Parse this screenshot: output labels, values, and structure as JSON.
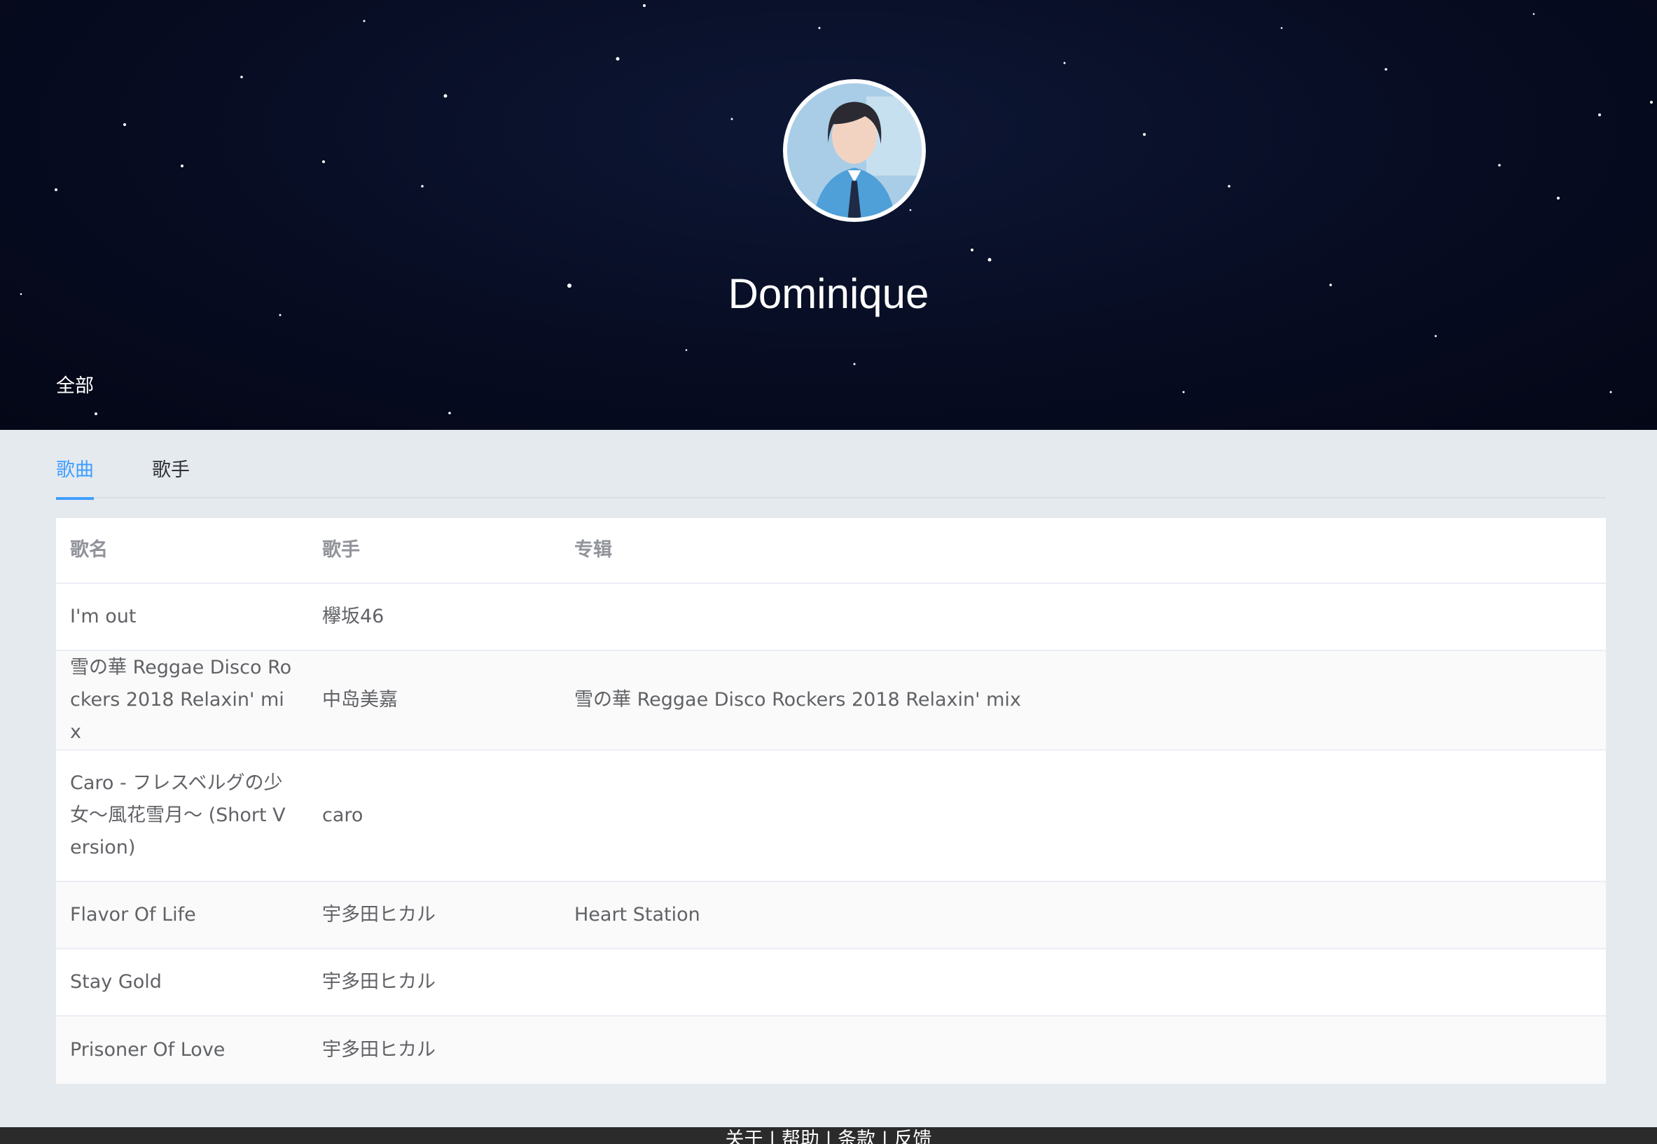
{
  "profile": {
    "username": "Dominique",
    "all_label": "全部"
  },
  "tabs": [
    {
      "label": "歌曲",
      "active": true
    },
    {
      "label": "歌手",
      "active": false
    }
  ],
  "table": {
    "headers": [
      "歌名",
      "歌手",
      "专辑"
    ],
    "rows": [
      {
        "title": "I'm out",
        "singer": "欅坂46",
        "album": ""
      },
      {
        "title": "雪の華 Reggae Disco Rockers 2018 Relaxin' mix",
        "singer": "中岛美嘉",
        "album": "雪の華 Reggae Disco Rockers 2018 Relaxin' mix"
      },
      {
        "title": "Caro - フレスベルグの少女〜風花雪月〜 (Short Version)",
        "singer": "caro",
        "album": ""
      },
      {
        "title": "Flavor Of Life",
        "singer": "宇多田ヒカル",
        "album": "Heart Station"
      },
      {
        "title": "Stay Gold",
        "singer": "宇多田ヒカル",
        "album": ""
      },
      {
        "title": "Prisoner Of Love",
        "singer": "宇多田ヒカル",
        "album": ""
      }
    ]
  },
  "footer": {
    "links": [
      "关于",
      "帮助",
      "条款",
      "反馈"
    ],
    "separator": "|"
  },
  "colors": {
    "accent": "#409eff",
    "hero_bg": "#070c22",
    "page_bg": "#e5eaef",
    "footer_bg": "#2b2b2b"
  }
}
